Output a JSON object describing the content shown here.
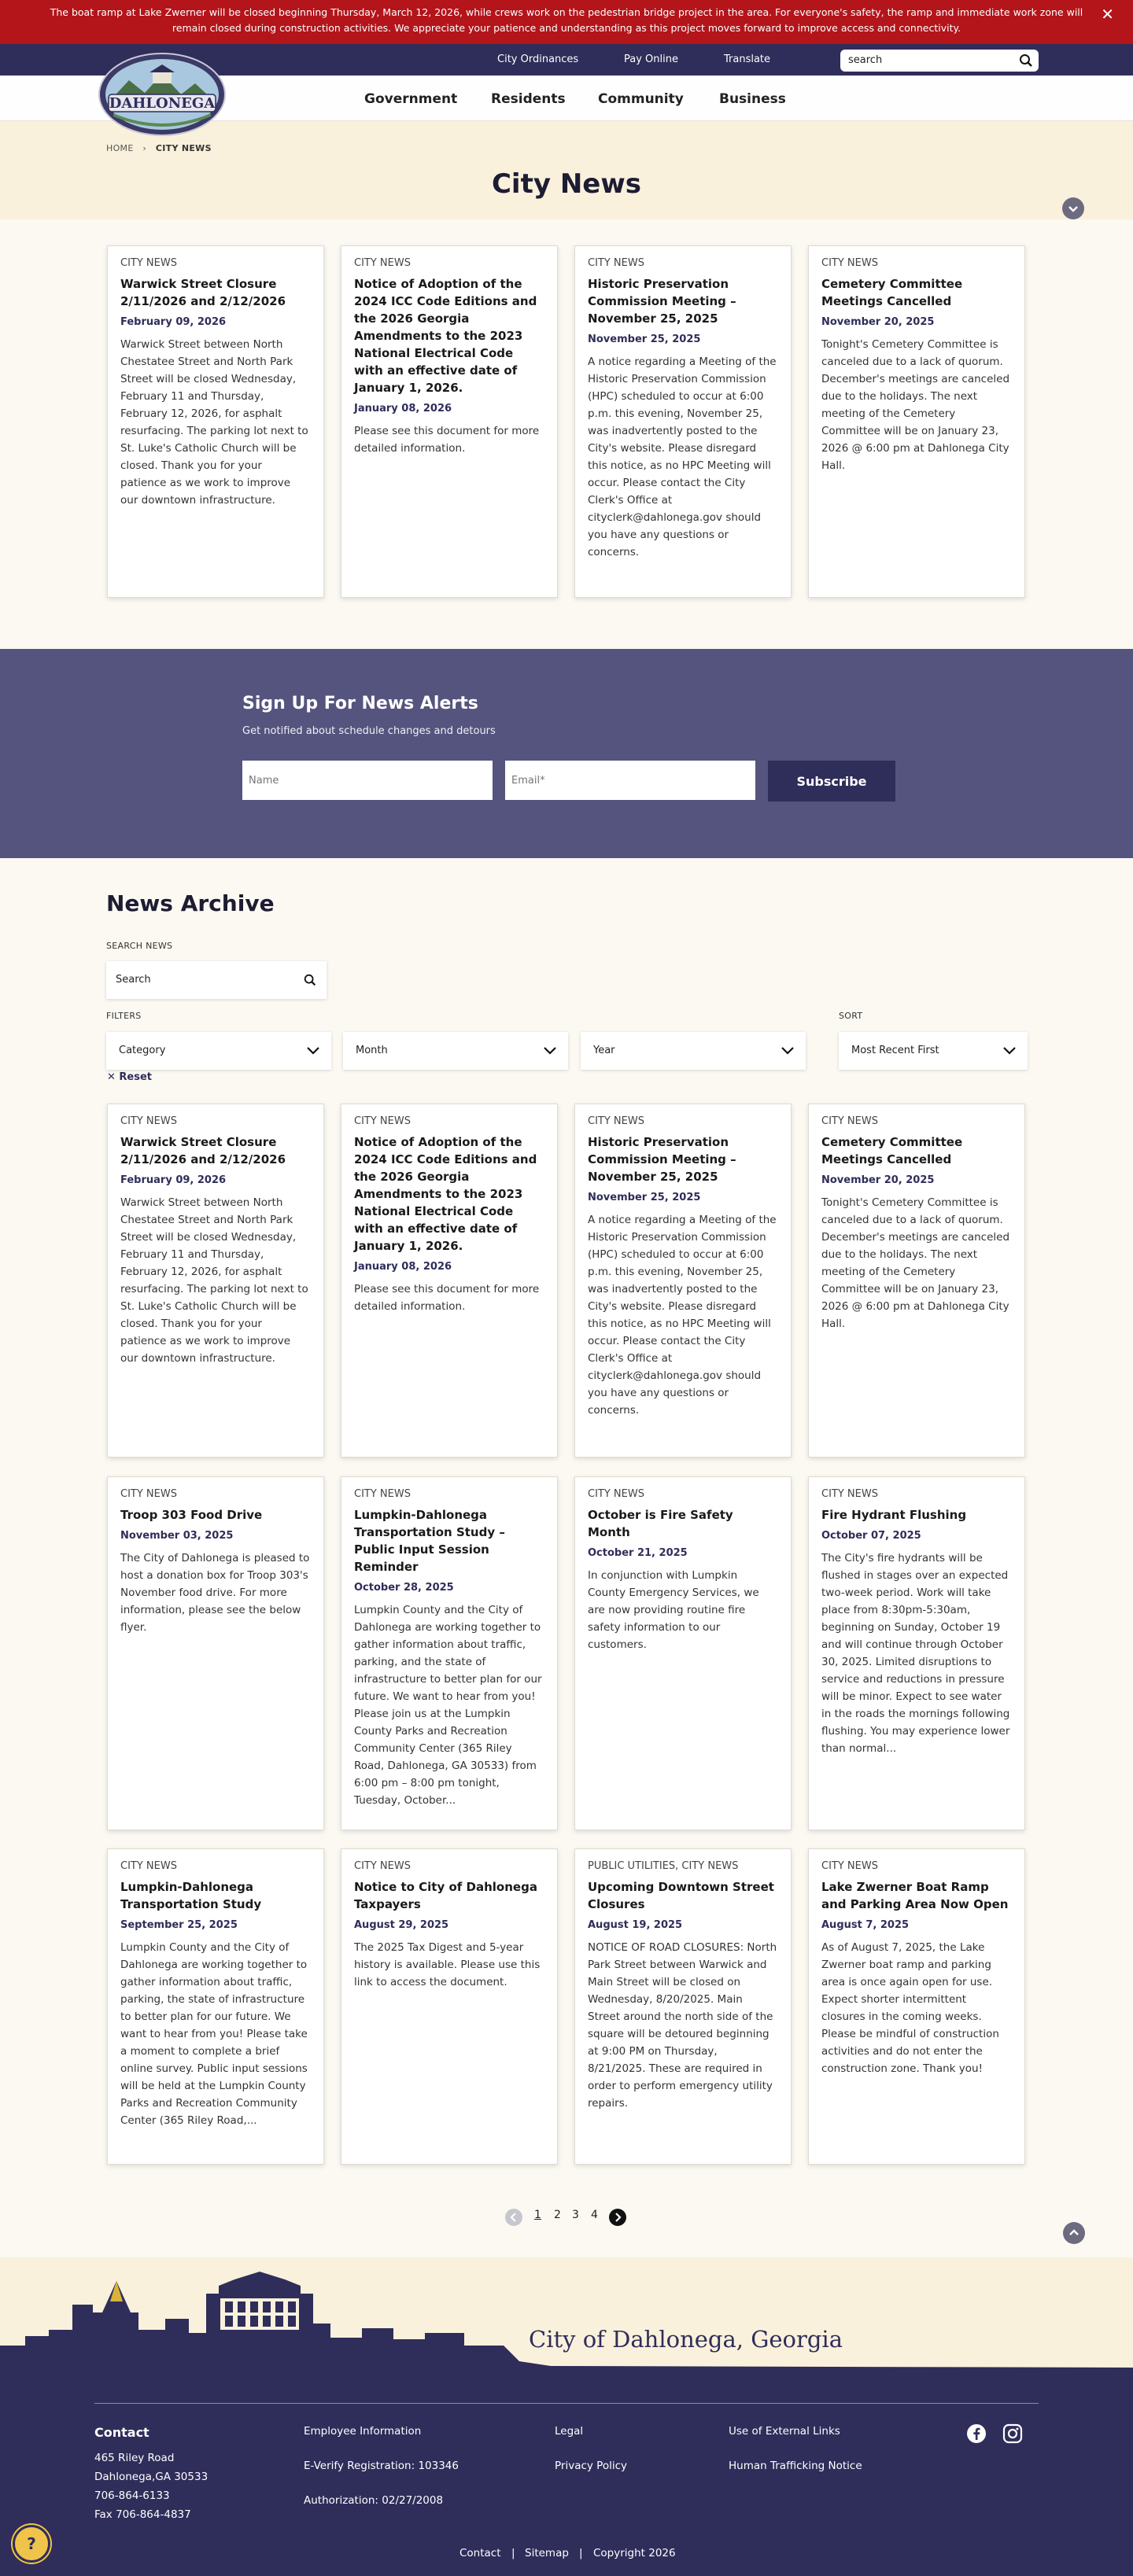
{
  "alert": {
    "text": "The boat ramp at Lake Zwerner will be closed beginning Thursday, March 12, 2026, while crews work on the pedestrian bridge project in the area. For everyone's safety, the ramp and immediate work zone will remain closed during construction activities. We appreciate your patience and understanding as this project moves forward to improve access and connectivity.",
    "close": "✕"
  },
  "utility": {
    "links": [
      "City Ordinances",
      "Pay Online",
      "Translate"
    ],
    "search_placeholder": "search"
  },
  "logo": {
    "text": "DAHLONEGA",
    "alt": "City of Dahlonega seal"
  },
  "nav": [
    "Government",
    "Residents",
    "Community",
    "Business"
  ],
  "breadcrumb": {
    "home": "HOME",
    "current": "CITY NEWS",
    "separator": "›"
  },
  "page_title": "City News",
  "featured": [
    {
      "category": "CITY NEWS",
      "title": "Warwick Street Closure 2/11/2026 and 2/12/2026",
      "date": "February 09, 2026",
      "body": "Warwick Street between North Chestatee Street and North Park Street will be closed Wednesday, February 11 and Thursday, February 12, 2026, for asphalt resurfacing. The parking lot next to St. Luke's Catholic Church will be closed. Thank you for your patience as we work to improve our downtown infrastructure."
    },
    {
      "category": "CITY NEWS",
      "title": "Notice of Adoption of the 2024 ICC Code Editions and the 2026 Georgia Amendments to the 2023 National Electrical Code with an effective date of January 1, 2026.",
      "date": "January 08, 2026",
      "body": "Please see this document for more detailed information."
    },
    {
      "category": "CITY NEWS",
      "title": "Historic Preservation Commission Meeting – November 25, 2025",
      "date": "November 25, 2025",
      "body": "A notice regarding a Meeting of the Historic Preservation Commission (HPC) scheduled to occur at 6:00 p.m. this evening, November 25, was inadvertently posted to the City's website.  Please disregard this notice, as no HPC Meeting will occur. Please contact the City Clerk's Office at cityclerk@dahlonega.gov should you have any questions or concerns."
    },
    {
      "category": "CITY NEWS",
      "title": "Cemetery Committee Meetings Cancelled",
      "date": "November 20, 2025",
      "body": "Tonight's Cemetery Committee is canceled due to a lack of quorum. December's meetings are canceled due to the holidays. The next meeting of the Cemetery Committee will be on January 23, 2026 @ 6:00 pm at Dahlonega City Hall."
    }
  ],
  "signup": {
    "heading": "Sign Up For News Alerts",
    "subtext": "Get notified about schedule changes and detours",
    "name_placeholder": "Name",
    "email_placeholder": "Email*",
    "button": "Subscribe"
  },
  "archive": {
    "title": "News Archive",
    "search_label": "SEARCH NEWS",
    "search_placeholder": "Search",
    "filters_label": "FILTERS",
    "sort_label": "SORT",
    "filters": [
      "Category",
      "Month",
      "Year"
    ],
    "sort_value": "Most Recent First",
    "reset": "✕ Reset"
  },
  "archive_cards": [
    {
      "category": "CITY NEWS",
      "title": "Warwick Street Closure 2/11/2026 and 2/12/2026",
      "date": "February 09, 2026",
      "body": "Warwick Street between North Chestatee Street and North Park Street will be closed Wednesday, February 11 and Thursday, February 12, 2026, for asphalt resurfacing. The parking lot next to St. Luke's Catholic Church will be closed. Thank you for your patience as we work to improve our downtown infrastructure."
    },
    {
      "category": "CITY NEWS",
      "title": "Notice of Adoption of the 2024 ICC Code Editions and the 2026 Georgia Amendments to the 2023 National Electrical Code with an effective date of January 1, 2026.",
      "date": "January 08, 2026",
      "body": "Please see this document for more detailed information."
    },
    {
      "category": "CITY NEWS",
      "title": "Historic Preservation Commission Meeting – November 25, 2025",
      "date": "November 25, 2025",
      "body": "A notice regarding a Meeting of the Historic Preservation Commission (HPC) scheduled to occur at 6:00 p.m. this evening, November 25, was inadvertently posted to the City's website.  Please disregard this notice, as no HPC Meeting will occur. Please contact the City Clerk's Office at cityclerk@dahlonega.gov should you have any questions or concerns."
    },
    {
      "category": "CITY NEWS",
      "title": "Cemetery Committee Meetings Cancelled",
      "date": "November 20, 2025",
      "body": "Tonight's Cemetery Committee is canceled due to a lack of quorum. December's meetings are canceled due to the holidays. The next meeting of the Cemetery Committee will be on January 23, 2026 @ 6:00 pm at Dahlonega City Hall."
    },
    {
      "category": "CITY NEWS",
      "title": "Troop 303 Food Drive",
      "date": "November 03, 2025",
      "body": "The City of Dahlonega is pleased to host a donation box for Troop 303's November food drive. For more information, please see the below flyer."
    },
    {
      "category": "CITY NEWS",
      "title": "Lumpkin-Dahlonega Transportation Study – Public Input Session Reminder",
      "date": "October 28, 2025",
      "body": "Lumpkin County and the City of Dahlonega are working together to gather information about traffic, parking, and the state of infrastructure to better plan for our future. We want to hear from you! Please join us at the Lumpkin County Parks and Recreation Community Center (365 Riley Road, Dahlonega, GA 30533) from 6:00 pm – 8:00 pm tonight, Tuesday, October..."
    },
    {
      "category": "CITY NEWS",
      "title": "October is Fire Safety Month",
      "date": "October 21, 2025",
      "body": "In conjunction with Lumpkin County Emergency Services, we are now providing routine fire safety information to our customers."
    },
    {
      "category": "CITY NEWS",
      "title": "Fire Hydrant Flushing",
      "date": "October 07, 2025",
      "body": "The City's fire hydrants will be flushed in stages over an expected two-week period. Work will take place from 8:30pm-5:30am, beginning on Sunday, October 19 and will continue through October 30, 2025. Limited disruptions to service and reductions in pressure will be minor. Expect to see water in the roads the mornings following flushing. You may experience lower than normal..."
    },
    {
      "category": "CITY NEWS",
      "title": "Lumpkin-Dahlonega Transportation Study",
      "date": "September 25, 2025",
      "body": "Lumpkin County and the City of Dahlonega are working together to gather information about traffic, parking, the state of infrastructure to better plan for our future. We want to hear from you! Please take a moment to complete a brief online survey. Public input sessions will be held at the Lumpkin County Parks and Recreation Community Center (365 Riley Road,..."
    },
    {
      "category": "CITY NEWS",
      "title": "Notice to City of Dahlonega Taxpayers",
      "date": "August 29, 2025",
      "body": "The 2025 Tax Digest and 5-year history is available. Please use this link to access the document."
    },
    {
      "category": "PUBLIC UTILITIES, CITY NEWS",
      "title": "Upcoming Downtown Street Closures",
      "date": "August 19, 2025",
      "body": "NOTICE OF ROAD CLOSURES: North Park Street between Warwick and Main Street will be closed on Wednesday, 8/20/2025. Main Street around the north side of the square will be detoured beginning at 9:00 PM on Thursday, 8/21/2025. These are required in order to perform emergency utility repairs."
    },
    {
      "category": "CITY NEWS",
      "title": "Lake Zwerner Boat Ramp and Parking Area Now Open",
      "date": "August 7, 2025",
      "body": "As of August 7, 2025, the Lake Zwerner boat ramp and parking area is once again open for use. Expect shorter intermittent closures in the coming weeks.  Please be mindful of construction activities and do not enter the construction zone. Thank you!"
    }
  ],
  "pagination": {
    "pages": [
      "1",
      "2",
      "3",
      "4"
    ],
    "current": "1"
  },
  "footer": {
    "city_name": "City of Dahlonega, Georgia",
    "contact_heading": "Contact",
    "address1": "465 Riley Road",
    "address2": "Dahlonega,GA 30533",
    "phone": "706-864-6133",
    "fax": "Fax 706-864-4837",
    "col2": [
      "Employee Information",
      "E-Verify Registration: 103346",
      "Authorization: 02/27/2008"
    ],
    "col3": [
      "Legal",
      "Privacy Policy"
    ],
    "col4": [
      "Use of External Links",
      "Human Trafficking Notice"
    ],
    "bottom": [
      "Contact",
      "Sitemap",
      "Copyright 2026"
    ],
    "separator": "|",
    "help": "?"
  },
  "colors": {
    "alert": "#b3151b",
    "navy": "#2f2d5a",
    "signup": "#55547e",
    "cream": "#f9f1dc",
    "help": "#f0c44a"
  },
  "icons": [
    "close-icon",
    "search-icon",
    "chevron-down-icon",
    "chevron-right-icon",
    "chevron-left-icon",
    "chevron-up-icon",
    "facebook-icon",
    "instagram-icon",
    "question-icon"
  ]
}
